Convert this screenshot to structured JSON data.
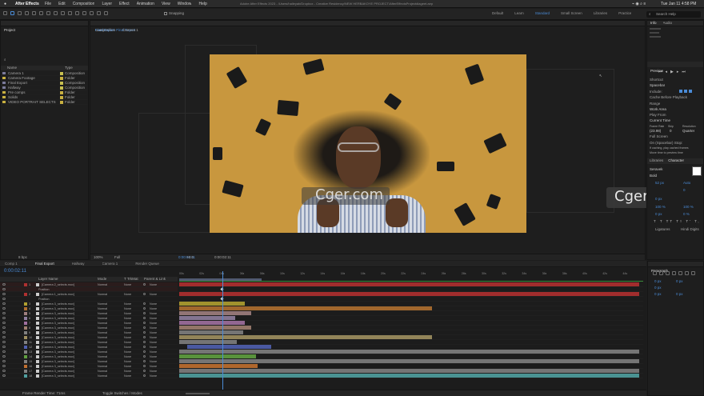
{
  "menubar": {
    "app": "After Effects",
    "items": [
      "File",
      "Edit",
      "Composition",
      "Layer",
      "Effect",
      "Animation",
      "View",
      "Window",
      "Help"
    ],
    "title": "Adobe After Effects 2023 - /Users/haileyab/Dropbox - Creative Residency/NEW HERBAKOYE PROJECT/AfterEffectsProjectdiageet.aep",
    "clock": "Tue Jan 11 4:58 PM"
  },
  "toolbar": {
    "snapping": "Snapping",
    "workspaces": [
      "Default",
      "Learn",
      "Standard",
      "Small Screen",
      "Libraries",
      "Practice"
    ],
    "search": "Search Help"
  },
  "project": {
    "title": "Project",
    "cols": [
      "Name",
      "Type"
    ],
    "items": [
      {
        "name": "Camera 1",
        "type": "Composition",
        "color": "#c8c050"
      },
      {
        "name": "Camera Footage",
        "type": "Folder",
        "color": "#c8b040"
      },
      {
        "name": "Final Export",
        "type": "Composition",
        "color": "#c8c050"
      },
      {
        "name": "Hallway",
        "type": "Composition",
        "color": "#c8c050"
      },
      {
        "name": "Pre comps",
        "type": "Folder",
        "color": "#c8b040"
      },
      {
        "name": "Solids",
        "type": "Folder",
        "color": "#c8b040"
      },
      {
        "name": "VIDEO PORTRAIT SELECTS",
        "type": "Folder",
        "color": "#c8b040"
      }
    ],
    "bpc": "8 bpc"
  },
  "comp": {
    "title": "Composition",
    "name": "Final Export",
    "breadcrumb": [
      "Final Export",
      "Camera 1"
    ],
    "zoom": "100%",
    "res": "Full",
    "time": "0:00:02:11",
    "offset": "+0.0"
  },
  "watermark": "Cger.com",
  "info": {
    "tabs": [
      "Info",
      "Audio"
    ]
  },
  "preview": {
    "title": "Preview",
    "shortcut_label": "Shortcut",
    "shortcut": "Spacebar",
    "include": "Include:",
    "cache": "Cache Before Playback",
    "range_label": "Range",
    "range": "Work Area",
    "play_from_label": "Play From",
    "play_from": "Current Time",
    "fr_label": "Frame Rate",
    "skip_label": "Skip",
    "res_label": "Resolution",
    "fr": "(23.98)",
    "skip": "0",
    "res": "Quarter",
    "fullscreen": "Full Screen",
    "stop_label": "On (Spacebar) Stop:",
    "stop1": "If caching, play cached frames",
    "stop2": "Move time to preview time"
  },
  "libraries": {
    "tabs": [
      "Libraries",
      "Character"
    ],
    "font": "Seravek",
    "style": "Bold",
    "size": "52 px",
    "leading": "Auto",
    "tracking": "0",
    "px1": "0 px",
    "pct1": "100 %",
    "pct2": "100 %",
    "px2": "0 px",
    "pct3": "0 %",
    "ligatures": "Ligatures",
    "hindi": "Hindi Digits"
  },
  "paragraph": {
    "title": "Paragraph",
    "vals": [
      "0 px",
      "0 px",
      "0 px",
      "0 px",
      "0 px"
    ]
  },
  "timeline": {
    "tabs": [
      "Comp 1",
      "Final Export",
      "Hallway",
      "Camera 1",
      "Render Queue"
    ],
    "time": "0:00:02:11",
    "cols": [
      "Layer Name",
      "Mode",
      "T TrkMat",
      "Parent & Link"
    ],
    "ticks": [
      "00s",
      "02s",
      "04s",
      "06s",
      "08s",
      "10s",
      "12s",
      "14s",
      "16s",
      "18s",
      "20s",
      "22s",
      "24s",
      "26s",
      "28s",
      "30s",
      "32s",
      "34s",
      "36s",
      "38s",
      "40s",
      "42s",
      "44s"
    ],
    "layers": [
      {
        "n": "1",
        "name": "[Camera 2_selects.mov]",
        "mode": "Normal",
        "mat": "None",
        "parent": "None",
        "color": "#b03030"
      },
      {
        "n": "",
        "name": "Position",
        "mode": "",
        "mat": "",
        "parent": "",
        "color": ""
      },
      {
        "n": "2",
        "name": "[Camera 1_selects.mov]",
        "mode": "Normal",
        "mat": "None",
        "parent": "None",
        "color": "#b03030"
      },
      {
        "n": "",
        "name": "Position",
        "mode": "",
        "mat": "",
        "parent": "",
        "color": ""
      },
      {
        "n": "3",
        "name": "[Camera 3_selects.mov]",
        "mode": "Normal",
        "mat": "None",
        "parent": "None",
        "color": "#b0a030"
      },
      {
        "n": "4",
        "name": "[Camera 3_selects.mov]",
        "mode": "Normal",
        "mat": "None",
        "parent": "None",
        "color": "#b07030"
      },
      {
        "n": "5",
        "name": "[Camera 3_selects.mov]",
        "mode": "Normal",
        "mat": "None",
        "parent": "None",
        "color": "#a08080"
      },
      {
        "n": "6",
        "name": "[Camera 3_selects.mov]",
        "mode": "Normal",
        "mat": "None",
        "parent": "None",
        "color": "#9080a0"
      },
      {
        "n": "7",
        "name": "[Camera 3_selects.mov]",
        "mode": "Normal",
        "mat": "None",
        "parent": "None",
        "color": "#a070a0"
      },
      {
        "n": "8",
        "name": "[Camera 3_selects.mov]",
        "mode": "Normal",
        "mat": "None",
        "parent": "None",
        "color": "#a08070"
      },
      {
        "n": "9",
        "name": "[Camera 3_selects.mov]",
        "mode": "Normal",
        "mat": "None",
        "parent": "None",
        "color": "#808080"
      },
      {
        "n": "10",
        "name": "[Camera 3_selects.mov]",
        "mode": "Normal",
        "mat": "None",
        "parent": "None",
        "color": "#a09060"
      },
      {
        "n": "11",
        "name": "[Camera 3_selects.mov]",
        "mode": "Normal",
        "mat": "None",
        "parent": "None",
        "color": "#808080"
      },
      {
        "n": "12",
        "name": "[Camera 3_selects.mov]",
        "mode": "Normal",
        "mat": "None",
        "parent": "None",
        "color": "#5060b0"
      },
      {
        "n": "13",
        "name": "[Camera 3_selects.mov]",
        "mode": "Normal",
        "mat": "None",
        "parent": "None",
        "color": "#808080"
      },
      {
        "n": "14",
        "name": "[Camera 3_selects.mov]",
        "mode": "Normal",
        "mat": "None",
        "parent": "None",
        "color": "#60a040"
      },
      {
        "n": "15",
        "name": "[Camera 3_selects.mov]",
        "mode": "Normal",
        "mat": "None",
        "parent": "None",
        "color": "#808080"
      },
      {
        "n": "16",
        "name": "[Camera 3_selects.mov]",
        "mode": "Normal",
        "mat": "None",
        "parent": "None",
        "color": "#c07030"
      },
      {
        "n": "17",
        "name": "[Camera 3_selects.mov]",
        "mode": "Normal",
        "mat": "None",
        "parent": "None",
        "color": "#808080"
      },
      {
        "n": "18",
        "name": "[Camera 3_selects.mov]",
        "mode": "Normal",
        "mat": "None",
        "parent": "None",
        "color": "#50a0a0"
      }
    ],
    "footer": "Frame Render Time: 71ms",
    "footer2": "Toggle Switches / Modes"
  }
}
